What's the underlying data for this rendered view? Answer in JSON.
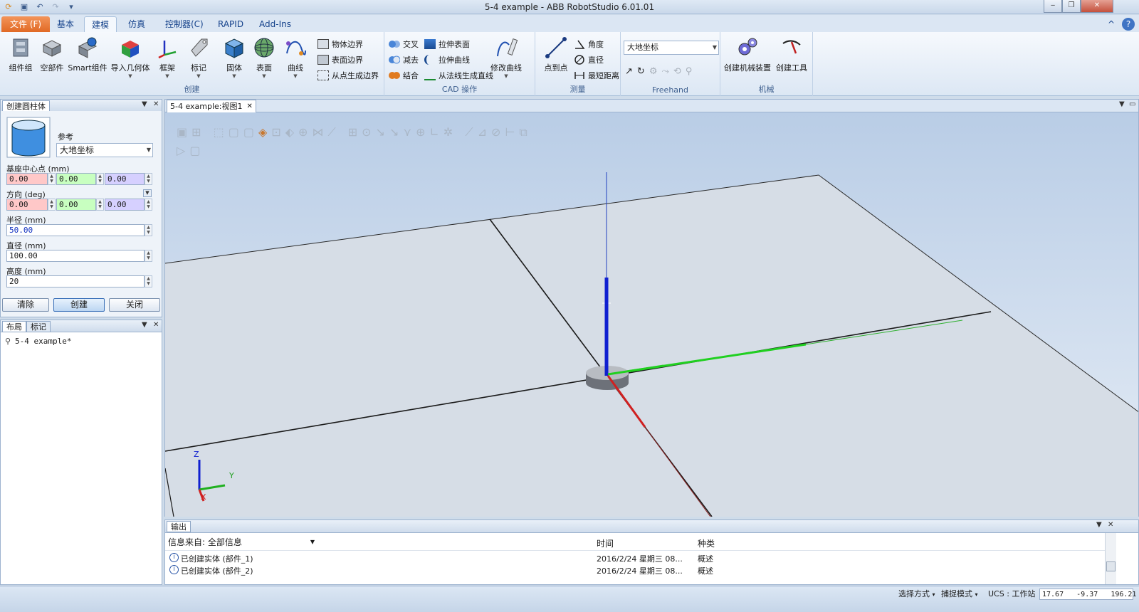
{
  "window": {
    "title": "5-4 example - ABB RobotStudio 6.01.01",
    "controls": {
      "minimize": "‒",
      "restore": "❐",
      "close": "✕"
    }
  },
  "quick_access": [
    "save-icon",
    "undo-icon",
    "redo-icon",
    "customize-icon"
  ],
  "ribbon_tabs": [
    "文件 (F)",
    "基本",
    "建模",
    "仿真",
    "控制器(C)",
    "RAPID",
    "Add-Ins"
  ],
  "ribbon_right": {
    "minimize": "^",
    "help": "?"
  },
  "groups": {
    "create": {
      "label": "创建",
      "buttons": [
        "组件组",
        "空部件",
        "Smart组件",
        "导入几何体",
        "框架",
        "标记",
        "固体",
        "表面",
        "曲线"
      ],
      "small": [
        "物体边界",
        "表面边界",
        "从点生成边界"
      ]
    },
    "cad": {
      "label": "CAD 操作",
      "small": [
        "交叉",
        "减去",
        "结合",
        "拉伸表面",
        "拉伸曲线",
        "从法线生成直线"
      ],
      "buttons": [
        "修改曲线"
      ]
    },
    "measure": {
      "label": "测量",
      "buttons": [
        "点到点"
      ],
      "small": [
        "角度",
        "直径",
        "最短距离"
      ]
    },
    "freehand": {
      "label": "Freehand",
      "combo": "大地坐标"
    },
    "mechanism": {
      "label": "机械",
      "buttons": [
        "创建机械装置",
        "创建工具"
      ]
    }
  },
  "create_panel": {
    "title": "创建圆柱体",
    "reference_label": "参考",
    "reference_value": "大地坐标",
    "base_center_label": "基座中心点 (mm)",
    "base_center": [
      "0.00",
      "0.00",
      "0.00"
    ],
    "orientation_label": "方向 (deg)",
    "orientation": [
      "0.00",
      "0.00",
      "0.00"
    ],
    "radius_label": "半径 (mm)",
    "radius": "50.00",
    "diameter_label": "直径 (mm)",
    "diameter": "100.00",
    "height_label": "高度 (mm)",
    "height": "20",
    "buttons": {
      "clear": "清除",
      "create": "创建",
      "close": "关闭"
    }
  },
  "layout_panel": {
    "tabs": [
      "布局",
      "标记"
    ],
    "tree_item": "5-4 example*"
  },
  "view": {
    "tab": "5-4 example:视图1",
    "axis_labels": {
      "x": "X",
      "y": "Y",
      "z": "Z"
    }
  },
  "output": {
    "title": "输出",
    "filter_label": "信息来自: 全部信息",
    "columns": [
      "时间",
      "种类"
    ],
    "rows": [
      {
        "message": "已创建实体 (部件_1)",
        "time": "2016/2/24 星期三 08...",
        "category": "概述"
      },
      {
        "message": "已创建实体 (部件_2)",
        "time": "2016/2/24 星期三 08...",
        "category": "概述"
      }
    ]
  },
  "status": {
    "selection_mode": "选择方式",
    "snap_mode": "捕捉模式",
    "ucs": "UCS : 工作站",
    "coords": "17.67   -9.37   196.21"
  },
  "colors": {
    "file_tab": "#e16a25",
    "axis_x": "#d02020",
    "axis_y": "#20c020",
    "axis_z": "#1020d0",
    "ribbon_text": "#15428b"
  }
}
